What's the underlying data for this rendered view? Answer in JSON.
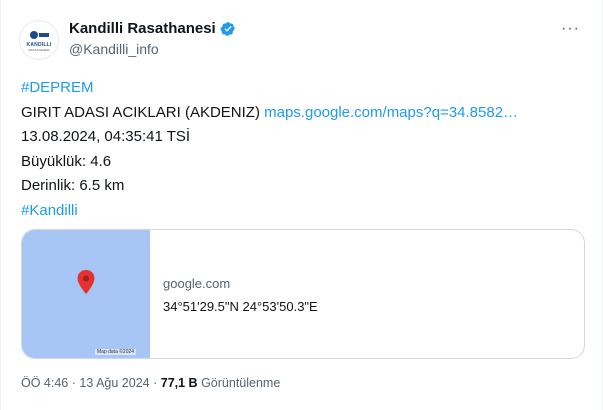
{
  "author": {
    "display_name": "Kandilli Rasathanesi",
    "handle": "@Kandilli_info",
    "avatar_text": "KANDILLI",
    "avatar_subtext": "RASATHANESI",
    "verified_color": "#1d9bf0"
  },
  "more_label": "···",
  "body": {
    "hashtag1": "#DEPREM",
    "location": "GIRIT ADASI ACIKLARI (AKDENIZ)",
    "map_link": "maps.google.com/maps?q=34.8582…",
    "datetime": "13.08.2024, 04:35:41 TSİ",
    "magnitude": "Büyüklük: 4.6",
    "depth": "Derinlik: 6.5 km",
    "hashtag2": "#Kandilli"
  },
  "card": {
    "domain": "google.com",
    "title": "34°51'29.5\"N 24°53'50.3\"E",
    "map_credit": "Map data ©2024",
    "map_color": "#a8c6f5",
    "pin_color": "#e5312f"
  },
  "meta": {
    "time": "ÖÖ 4:46",
    "date": "13 Ağu 2024",
    "views_count": "77,1 B",
    "views_label": "Görüntülenme",
    "separator": "·"
  },
  "colors": {
    "link": "#1d9bf0",
    "secondary_text": "#536471",
    "border": "#cfd9de"
  }
}
